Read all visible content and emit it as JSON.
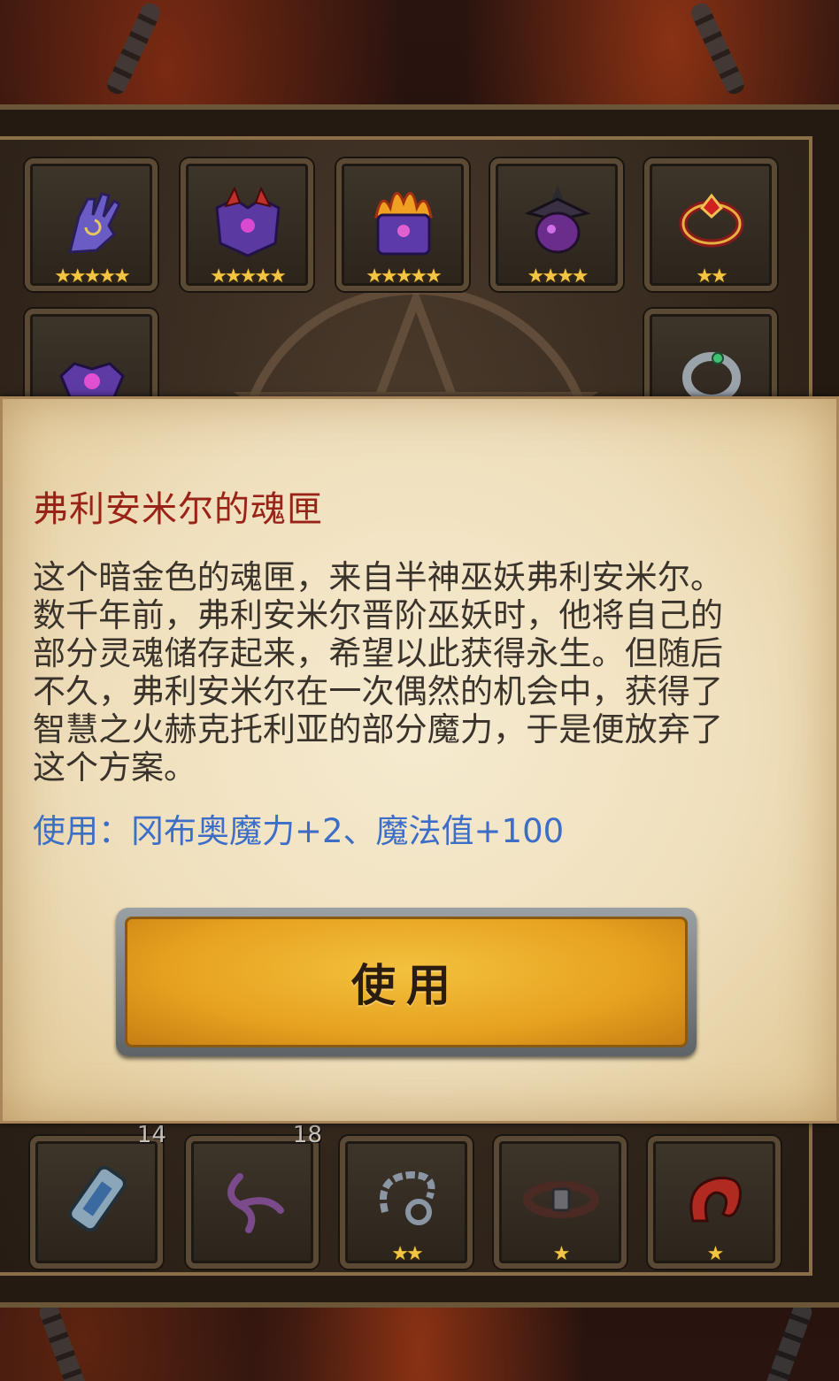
{
  "inventory": {
    "top_row": [
      {
        "icon": "glove-icon",
        "stars": "★★★★★"
      },
      {
        "icon": "armor-icon",
        "stars": "★★★★★"
      },
      {
        "icon": "flame-crown-icon",
        "stars": "★★★★★"
      },
      {
        "icon": "dark-lantern-icon",
        "stars": "★★★★"
      },
      {
        "icon": "ruby-ring-icon",
        "stars": "★★"
      }
    ],
    "second_row": [
      {
        "icon": "soul-box-icon"
      },
      {
        "icon": "silver-ring-icon"
      }
    ],
    "bottom_row": [
      {
        "icon": "hourglass-icon",
        "count": "14"
      },
      {
        "icon": "rope-icon",
        "count": "18"
      },
      {
        "icon": "chain-icon",
        "stars": "★★"
      },
      {
        "icon": "belt-icon",
        "stars": "★"
      },
      {
        "icon": "horn-icon",
        "stars": "★"
      }
    ]
  },
  "tooltip": {
    "title": "弗利安米尔的魂匣",
    "description": "这个暗金色的魂匣，来自半神巫妖弗利安米尔。数千年前，弗利安米尔晋阶巫妖时，他将自己的部分灵魂储存起来，希望以此获得永生。但随后不久，弗利安米尔在一次偶然的机会中，获得了智慧之火赫克托利亚的部分魔力，于是便放弃了这个方案。",
    "effect": "使用：冈布奥魔力+2、魔法值+100",
    "use_button": "使用"
  },
  "colors": {
    "title": "#9a2318",
    "effect": "#3c6ec8",
    "button": "#e6a21f",
    "stars": "#f3c544"
  }
}
